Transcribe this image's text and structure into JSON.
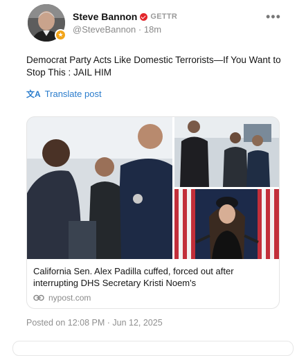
{
  "author": {
    "display_name": "Steve Bannon",
    "platform_tag": "GETTR",
    "handle": "@SteveBannon",
    "time_ago": "18m",
    "badge_color": "#f2a51a",
    "verified_color": "#e3262b"
  },
  "post": {
    "text": "Democrat Party Acts Like Domestic Terrorists—If You Want to Stop This : JAIL HIM",
    "translate_label": "Translate post",
    "translate_icon": "translate-icon"
  },
  "link_card": {
    "title": "California Sen. Alex Padilla cuffed, forced out after interrupting DHS Secretary Kristi Noem's",
    "domain": "nypost.com",
    "link_icon": "link-icon"
  },
  "footer": {
    "posted_on": "Posted on 12:08 PM · Jun 12, 2025"
  },
  "colors": {
    "accent": "#2a7ccc",
    "muted": "#8a8a8a"
  }
}
